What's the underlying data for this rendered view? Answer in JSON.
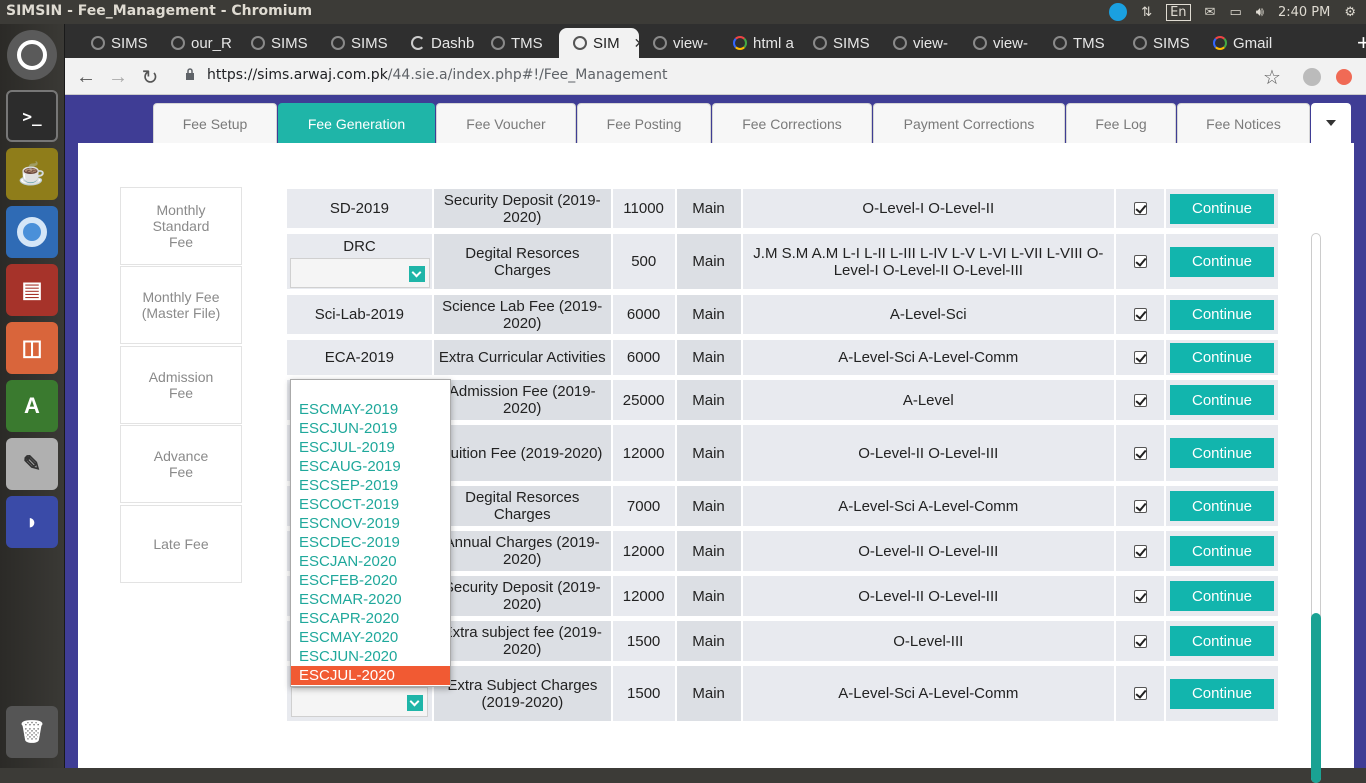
{
  "os": {
    "window_title": "SIMSIN - Fee_Management - Chromium",
    "keyboard_layout": "En",
    "clock": "2:40 PM"
  },
  "browser": {
    "tabs": [
      {
        "label": "SIMS"
      },
      {
        "label": "our_R"
      },
      {
        "label": "SIMS"
      },
      {
        "label": "SIMS"
      },
      {
        "label": "Dashb"
      },
      {
        "label": "TMS"
      },
      {
        "label": "SIM",
        "active": true
      },
      {
        "label": "view-"
      },
      {
        "label": "html a"
      },
      {
        "label": "SIMS"
      },
      {
        "label": "view-"
      },
      {
        "label": "view-"
      },
      {
        "label": "TMS"
      },
      {
        "label": "SIMS"
      },
      {
        "label": "Gmail"
      }
    ],
    "url_host": "https://sims.arwaj.com.pk",
    "url_path": "/44.sie.a/index.php#!/Fee_Management"
  },
  "nav_tabs": [
    {
      "label": "Fee Setup"
    },
    {
      "label": "Fee Generation",
      "active": true
    },
    {
      "label": "Fee Voucher"
    },
    {
      "label": "Fee Posting"
    },
    {
      "label": "Fee Corrections"
    },
    {
      "label": "Payment Corrections"
    },
    {
      "label": "Fee Log"
    },
    {
      "label": "Fee Notices"
    }
  ],
  "side_menu": [
    {
      "label": "Monthly Standard Fee"
    },
    {
      "label": "Monthly Fee (Master File)"
    },
    {
      "label": "Admission Fee"
    },
    {
      "label": "Advance Fee"
    },
    {
      "label": "Late Fee"
    }
  ],
  "rows": [
    {
      "code": "SD-2019",
      "desc": "Security Deposit (2019-2020)",
      "amount": "11000",
      "type": "Main",
      "classes": "O-Level-I O-Level-II",
      "action": "Continue"
    },
    {
      "code": "DRC",
      "desc": "Degital Resorces Charges",
      "amount": "500",
      "type": "Main",
      "classes": "J.M S.M A.M L-I L-II L-III L-IV L-V L-VI L-VII L-VIII O-Level-I O-Level-II O-Level-III",
      "action": "Continue"
    },
    {
      "code": "Sci-Lab-2019",
      "desc": "Science Lab Fee (2019-2020)",
      "amount": "6000",
      "type": "Main",
      "classes": "A-Level-Sci",
      "action": "Continue"
    },
    {
      "code": "ECA-2019",
      "desc": "Extra Curricular Activities",
      "amount": "6000",
      "type": "Main",
      "classes": "A-Level-Sci A-Level-Comm",
      "action": "Continue"
    },
    {
      "code": "",
      "desc": "Admission Fee (2019-2020)",
      "amount": "25000",
      "type": "Main",
      "classes": "A-Level",
      "action": "Continue"
    },
    {
      "code": "",
      "desc": "Tuition Fee (2019-2020)",
      "amount": "12000",
      "type": "Main",
      "classes": "O-Level-II O-Level-III",
      "action": "Continue"
    },
    {
      "code": "",
      "desc": "Degital Resorces Charges",
      "amount": "7000",
      "type": "Main",
      "classes": "A-Level-Sci A-Level-Comm",
      "action": "Continue"
    },
    {
      "code": "",
      "desc": "Annual Charges (2019-2020)",
      "amount": "12000",
      "type": "Main",
      "classes": "O-Level-II O-Level-III",
      "action": "Continue"
    },
    {
      "code": "",
      "desc": "Security Deposit (2019-2020)",
      "amount": "12000",
      "type": "Main",
      "classes": "O-Level-II O-Level-III",
      "action": "Continue"
    },
    {
      "code": "",
      "desc": "Extra subject fee (2019-2020)",
      "amount": "1500",
      "type": "Main",
      "classes": "O-Level-III",
      "action": "Continue"
    },
    {
      "code": "",
      "desc": "Extra Subject Charges (2019-2020)",
      "amount": "1500",
      "type": "Main",
      "classes": "A-Level-Sci A-Level-Comm",
      "action": "Continue"
    }
  ],
  "dropdown_options": [
    {
      "label": "ESCMAY-2019"
    },
    {
      "label": "ESCJUN-2019"
    },
    {
      "label": "ESCJUL-2019"
    },
    {
      "label": "ESCAUG-2019"
    },
    {
      "label": "ESCSEP-2019"
    },
    {
      "label": "ESCOCT-2019"
    },
    {
      "label": "ESCNOV-2019"
    },
    {
      "label": "ESCDEC-2019"
    },
    {
      "label": "ESCJAN-2020"
    },
    {
      "label": "ESCFEB-2020"
    },
    {
      "label": "ESCMAR-2020"
    },
    {
      "label": "ESCAPR-2020"
    },
    {
      "label": "ESCMAY-2020"
    },
    {
      "label": "ESCJUN-2020"
    },
    {
      "label": "ESCJUL-2020",
      "selected": true
    }
  ],
  "colors": {
    "accent": "#1fb5a8",
    "button": "#12b5ad",
    "selected_option": "#f15a33",
    "page_bg": "#3f3d95"
  }
}
